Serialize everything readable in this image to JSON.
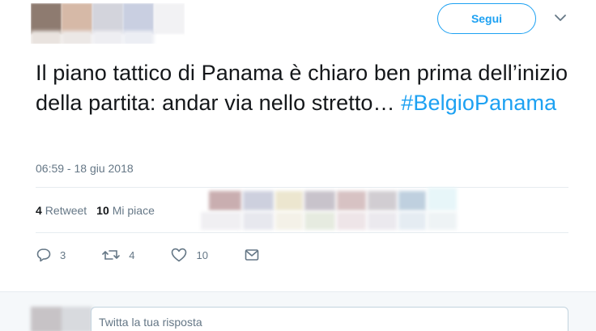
{
  "header": {
    "follow_label": "Segui",
    "caret_icon": "chevron-down-icon"
  },
  "tweet": {
    "text_main": "Il piano tattico di Panama è chiaro ben prima dell’inizio della partita: andar via nello stretto… ",
    "hashtag": "#BelgioPanama",
    "timestamp": "06:59 - 18 giu 2018"
  },
  "stats": {
    "retweets_count": "4",
    "retweets_label": "Retweet",
    "likes_count": "10",
    "likes_label": "Mi piace"
  },
  "actions": {
    "reply_count": "3",
    "retweet_count": "4",
    "like_count": "10"
  },
  "reply": {
    "placeholder": "Twitta la tua risposta"
  },
  "colors": {
    "accent": "#1da1f2",
    "secondary_text": "#657786",
    "reply_bg": "#f5f8fa"
  }
}
